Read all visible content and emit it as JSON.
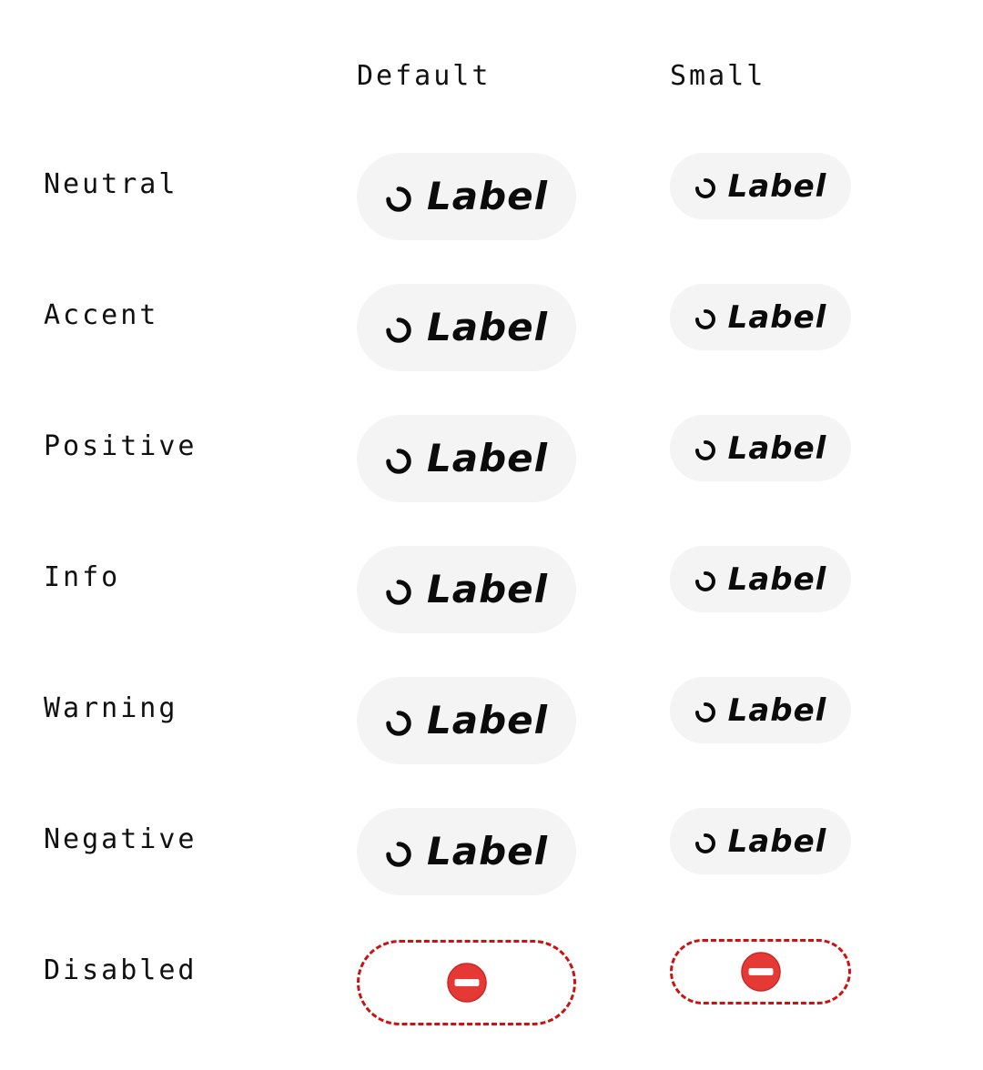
{
  "columns": {
    "default": "Default",
    "small": "Small"
  },
  "rows": [
    {
      "label": "Neutral",
      "button_label": "Label"
    },
    {
      "label": "Accent",
      "button_label": "Label"
    },
    {
      "label": "Positive",
      "button_label": "Label"
    },
    {
      "label": "Info",
      "button_label": "Label"
    },
    {
      "label": "Warning",
      "button_label": "Label"
    },
    {
      "label": "Negative",
      "button_label": "Label"
    },
    {
      "label": "Disabled"
    }
  ],
  "icons": {
    "loading": "spinner-icon",
    "disabled": "no-entry-icon"
  },
  "colors": {
    "button_background": "#f4f4f4",
    "disabled_border": "#cc1111",
    "disabled_icon": "#e53935"
  }
}
